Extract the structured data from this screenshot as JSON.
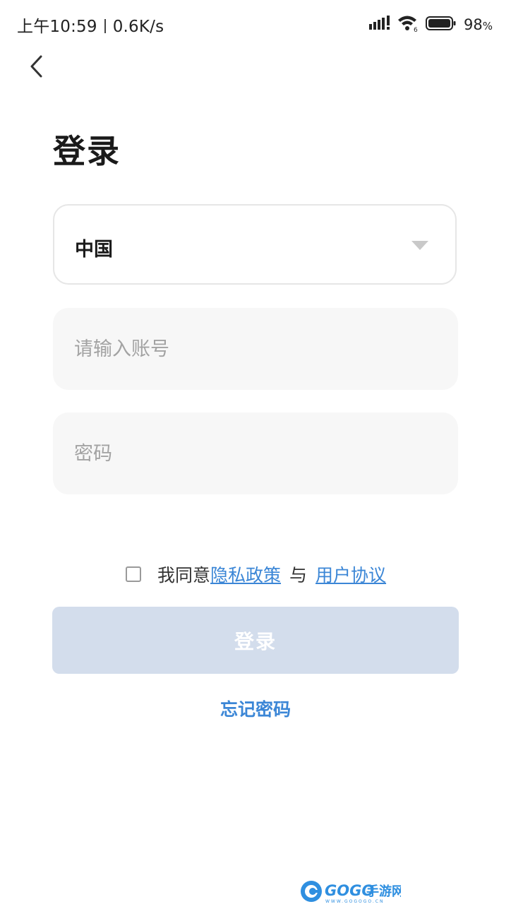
{
  "status_bar": {
    "time": "上午10:59",
    "network_speed": "0.6K/s",
    "battery_percent": "98",
    "battery_unit": "%",
    "icons": [
      "signal-icon",
      "wifi-icon",
      "battery-icon"
    ]
  },
  "nav": {
    "back_icon": "chevron-left-icon"
  },
  "page": {
    "title": "登录"
  },
  "form": {
    "region": {
      "value": "中国",
      "icon": "caret-down-icon"
    },
    "account": {
      "value": "",
      "placeholder": "请输入账号"
    },
    "password": {
      "value": "",
      "placeholder": "密码"
    },
    "agreement": {
      "checked": false,
      "prefix": "我同意",
      "privacy_link": "隐私政策",
      "conjunction": "与",
      "terms_link": "用户协议"
    },
    "submit_label": "登录",
    "submit_enabled": false,
    "forgot_password": "忘记密码"
  },
  "watermark": {
    "brand": "GOGO手游网",
    "url": "WWW.GOGOGO.CN"
  },
  "colors": {
    "link": "#3b86d6",
    "button_disabled": "#d3ddec",
    "input_bg": "#f7f7f7",
    "placeholder": "#a3a3a3"
  }
}
